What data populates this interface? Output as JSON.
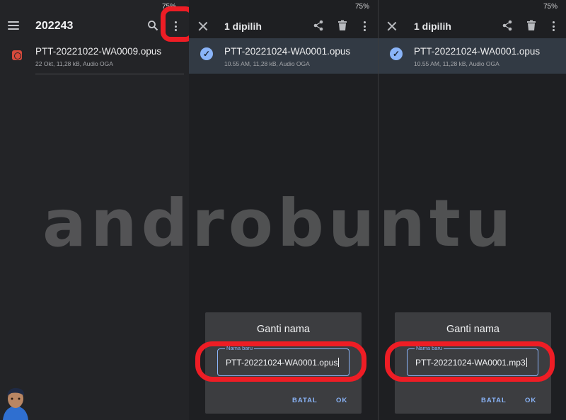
{
  "panel1": {
    "battery": "75%",
    "folder_title": "202243",
    "file": {
      "name": "PTT-20221022-WA0009.opus",
      "meta": "22 Okt, 11,28 kB, Audio OGA"
    }
  },
  "panel2": {
    "battery": "75%",
    "selection_count": "1 dipilih",
    "file": {
      "name": "PTT-20221024-WA0001.opus",
      "meta": "10.55 AM, 11,28 kB, Audio OGA"
    },
    "dialog": {
      "title": "Ganti nama",
      "field_label": "Nama baru",
      "field_value": "PTT-20221024-WA0001.opus",
      "cancel": "BATAL",
      "ok": "OK"
    }
  },
  "panel3": {
    "battery": "75%",
    "selection_count": "1 dipilih",
    "file": {
      "name": "PTT-20221024-WA0001.opus",
      "meta": "10.55 AM, 11,28 kB, Audio OGA"
    },
    "dialog": {
      "title": "Ganti nama",
      "field_label": "Nama baru",
      "field_value": "PTT-20221024-WA0001.mp3",
      "cancel": "BATAL",
      "ok": "OK"
    }
  },
  "watermark": "androbuntu",
  "colors": {
    "accent": "#8ab4f8",
    "highlight": "#ee1d25",
    "file_icon": "#d64a3c",
    "selection_bg": "#323a44"
  },
  "icons": [
    "menu-icon",
    "search-icon",
    "more-vert-icon",
    "close-icon",
    "share-icon",
    "delete-icon",
    "check-circle-icon",
    "audio-file-icon"
  ]
}
